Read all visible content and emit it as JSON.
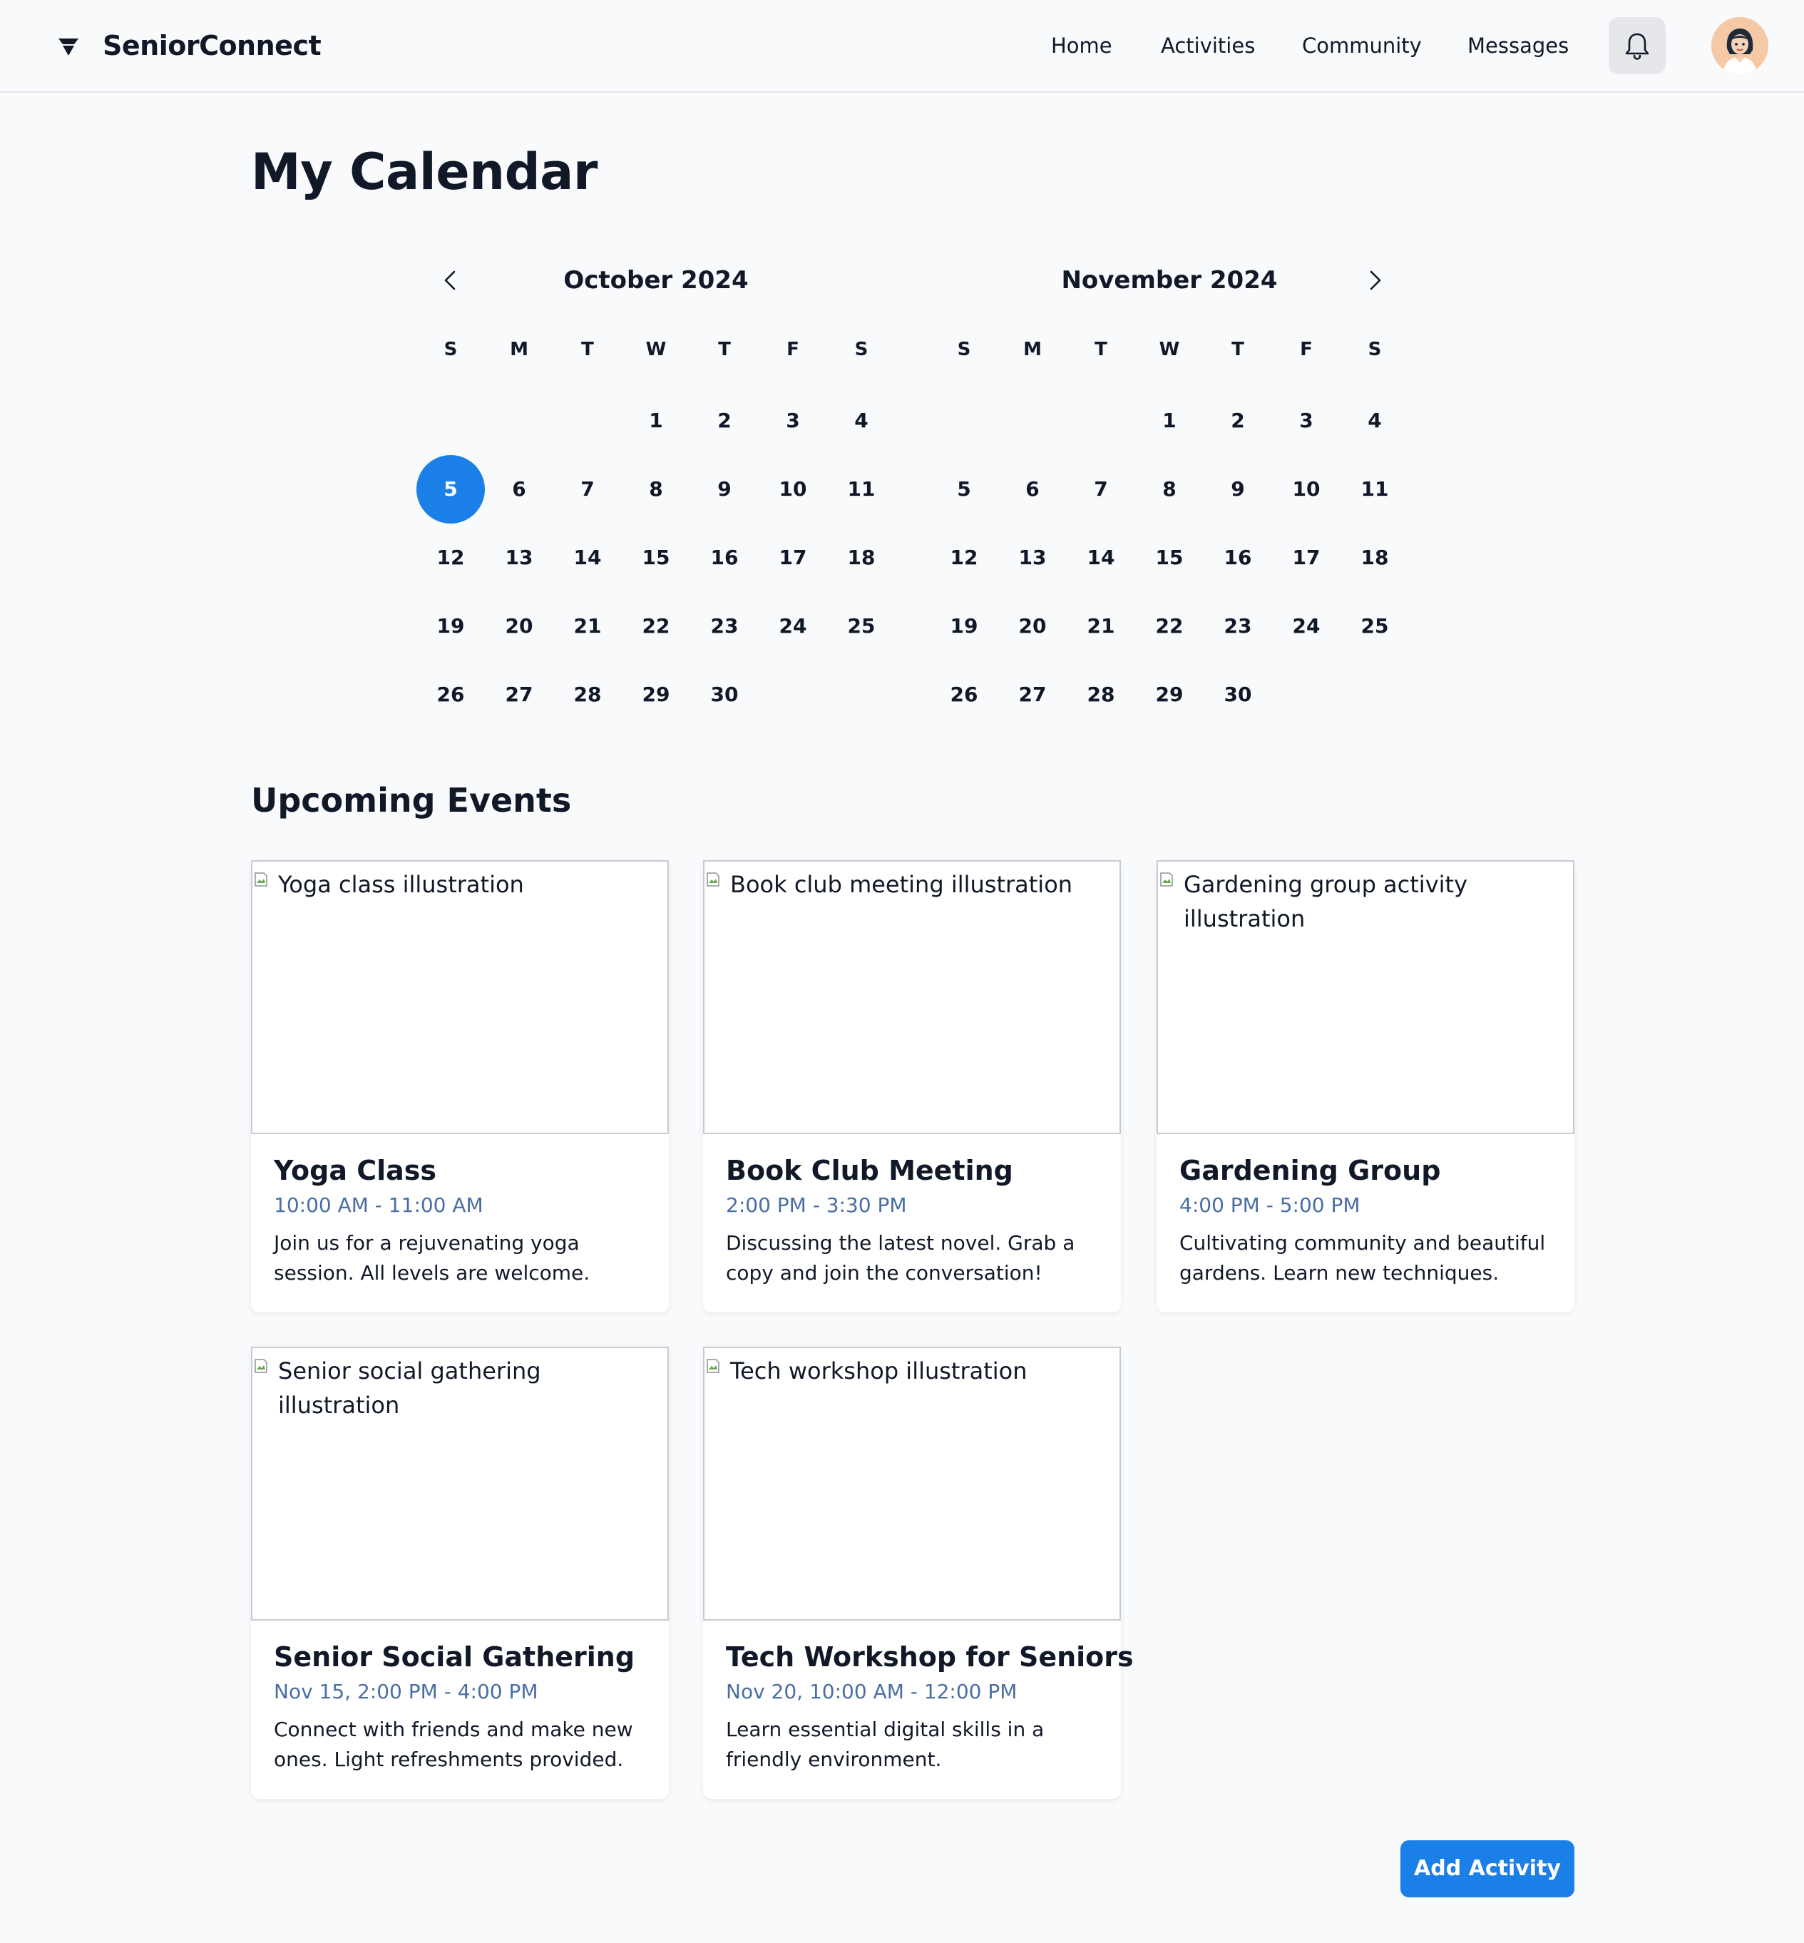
{
  "header": {
    "brand": "SeniorConnect",
    "nav": [
      "Home",
      "Activities",
      "Community",
      "Messages"
    ]
  },
  "page": {
    "title": "My Calendar"
  },
  "calendar": {
    "weekdays": [
      "S",
      "M",
      "T",
      "W",
      "T",
      "F",
      "S"
    ],
    "selected_day": 5,
    "months": [
      {
        "title": "October 2024",
        "first_weekday": 3,
        "days": 30
      },
      {
        "title": "November 2024",
        "first_weekday": 3,
        "days": 30
      }
    ]
  },
  "events": {
    "title": "Upcoming Events",
    "items": [
      {
        "alt": "Yoga class illustration",
        "title": "Yoga Class",
        "time": "10:00 AM - 11:00 AM",
        "desc": "Join us for a rejuvenating yoga session. All levels are welcome."
      },
      {
        "alt": "Book club meeting illustration",
        "title": "Book Club Meeting",
        "time": "2:00 PM - 3:30 PM",
        "desc": "Discussing the latest novel. Grab a copy and join the conversation!"
      },
      {
        "alt": "Gardening group activity illustration",
        "title": "Gardening Group",
        "time": "4:00 PM - 5:00 PM",
        "desc": "Cultivating community and beautiful gardens. Learn new techniques."
      },
      {
        "alt": "Senior social gathering illustration",
        "title": "Senior Social Gathering",
        "time": "Nov 15, 2:00 PM - 4:00 PM",
        "desc": "Connect with friends and make new ones. Light refreshments provided."
      },
      {
        "alt": "Tech workshop illustration",
        "title": "Tech Workshop for Seniors",
        "time": "Nov 20, 10:00 AM - 12:00 PM",
        "desc": "Learn essential digital skills in a friendly environment."
      }
    ]
  },
  "actions": {
    "add_activity": "Add Activity"
  },
  "colors": {
    "accent": "#1a7fe6",
    "time_text": "#4a6ea3",
    "background": "#f8fafc"
  },
  "icons": {
    "logo": "logo-icon",
    "notifications": "bell-icon",
    "prev": "chevron-left-icon",
    "next": "chevron-right-icon"
  }
}
